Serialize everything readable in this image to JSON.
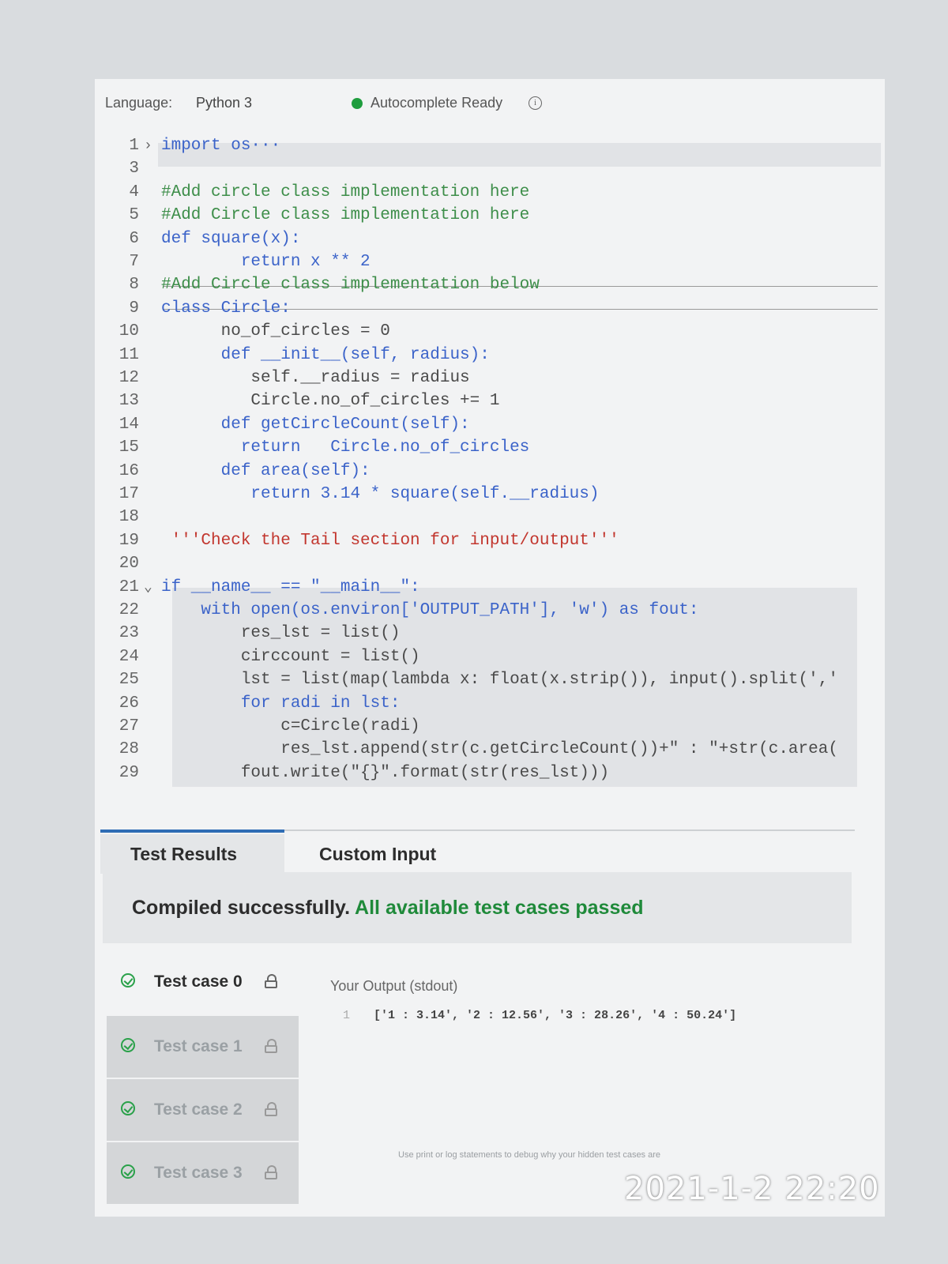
{
  "header": {
    "language_label": "Language:",
    "language_value": "Python 3",
    "status_text": "Autocomplete Ready",
    "status_color": "#1f9d3e",
    "info_icon": "info-icon"
  },
  "editor": {
    "lines": [
      {
        "num": "1",
        "fold": "›",
        "code": "import os···"
      },
      {
        "num": "3",
        "code": ""
      },
      {
        "num": "4",
        "code": "#Add circle class implementation here"
      },
      {
        "num": "5",
        "code": "#Add Circle class implementation here"
      },
      {
        "num": "6",
        "code": "def square(x):"
      },
      {
        "num": "7",
        "code": "        return x ** 2"
      },
      {
        "num": "8",
        "code": "#Add Circle class implementation below"
      },
      {
        "num": "9",
        "code": "class Circle:"
      },
      {
        "num": "10",
        "code": "      no_of_circles = 0"
      },
      {
        "num": "11",
        "code": "      def __init__(self, radius):"
      },
      {
        "num": "12",
        "code": "         self.__radius = radius"
      },
      {
        "num": "13",
        "code": "         Circle.no_of_circles += 1"
      },
      {
        "num": "14",
        "code": "      def getCircleCount(self):"
      },
      {
        "num": "15",
        "code": "        return   Circle.no_of_circles"
      },
      {
        "num": "16",
        "code": "      def area(self):"
      },
      {
        "num": "17",
        "code": "         return 3.14 * square(self.__radius)"
      },
      {
        "num": "18",
        "code": ""
      },
      {
        "num": "19",
        "code": " '''Check the Tail section for input/output'''"
      },
      {
        "num": "20",
        "code": ""
      },
      {
        "num": "21",
        "fold": "⌄",
        "code": "if __name__ == \"__main__\":"
      },
      {
        "num": "22",
        "code": "    with open(os.environ['OUTPUT_PATH'], 'w') as fout:"
      },
      {
        "num": "23",
        "code": "        res_lst = list()"
      },
      {
        "num": "24",
        "code": "        circcount = list()"
      },
      {
        "num": "25",
        "code": "        lst = list(map(lambda x: float(x.strip()), input().split(','"
      },
      {
        "num": "26",
        "code": "        for radi in lst:"
      },
      {
        "num": "27",
        "code": "            c=Circle(radi)"
      },
      {
        "num": "28",
        "code": "            res_lst.append(str(c.getCircleCount())+\" : \"+str(c.area("
      },
      {
        "num": "29",
        "code": "        fout.write(\"{}\".format(str(res_lst)))"
      }
    ]
  },
  "tabs": {
    "results": "Test Results",
    "custom": "Custom Input"
  },
  "banner": {
    "compiled": "Compiled successfully.",
    "passed": "All available test cases passed"
  },
  "test_cases": [
    {
      "label": "Test case 0"
    },
    {
      "label": "Test case 1"
    },
    {
      "label": "Test case 2"
    },
    {
      "label": "Test case 3"
    }
  ],
  "output": {
    "label": "Your Output (stdout)",
    "line_num": "1",
    "text": "['1 : 3.14', '2 : 12.56', '3 : 28.26', '4 : 50.24']"
  },
  "hint": "Use print or log statements to debug why your hidden test cases are",
  "timestamp": "2021-1-2 22:20"
}
